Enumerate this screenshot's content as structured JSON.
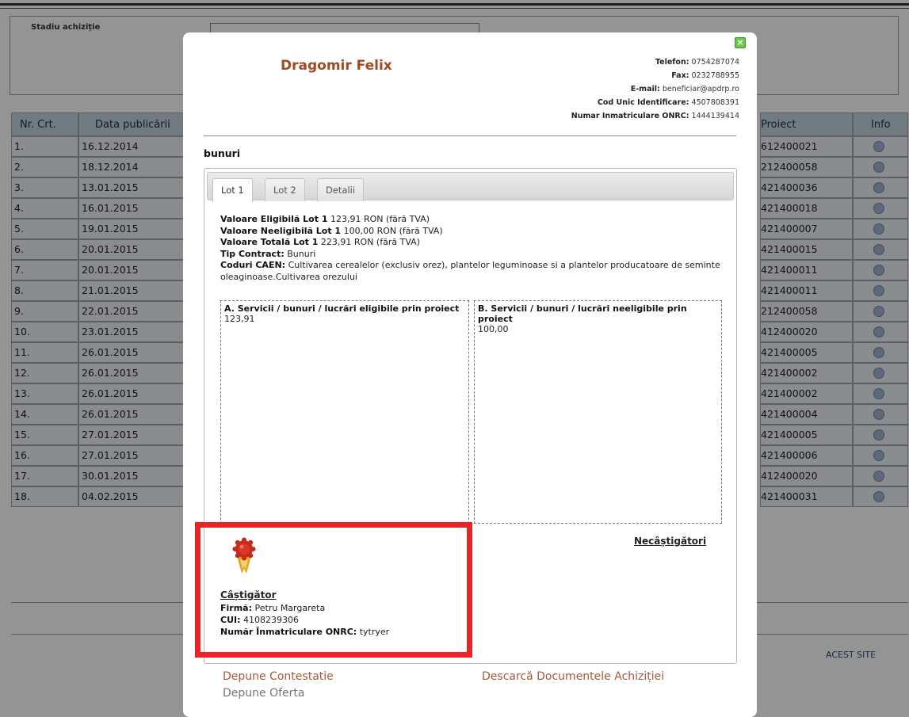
{
  "filter": {
    "label": "Stadiu achiziție"
  },
  "table": {
    "headers": [
      "Nr. Crt.",
      "Data publicării",
      "Proiect",
      "Info"
    ],
    "rows": [
      {
        "nr": "1.",
        "date": "16.12.2014",
        "proj": "612400021"
      },
      {
        "nr": "2.",
        "date": "18.12.2014",
        "proj": "212400058"
      },
      {
        "nr": "3.",
        "date": "13.01.2015",
        "proj": "421400036"
      },
      {
        "nr": "4.",
        "date": "16.01.2015",
        "proj": "421400018"
      },
      {
        "nr": "5.",
        "date": "19.01.2015",
        "proj": "421400007"
      },
      {
        "nr": "6.",
        "date": "20.01.2015",
        "proj": "421400015"
      },
      {
        "nr": "7.",
        "date": "20.01.2015",
        "proj": "421400011"
      },
      {
        "nr": "8.",
        "date": "21.01.2015",
        "proj": "421400011"
      },
      {
        "nr": "9.",
        "date": "22.01.2015",
        "proj": "212400058"
      },
      {
        "nr": "10.",
        "date": "23.01.2015",
        "proj": "412400020"
      },
      {
        "nr": "11.",
        "date": "26.01.2015",
        "proj": "421400005"
      },
      {
        "nr": "12.",
        "date": "26.01.2015",
        "proj": "421400002"
      },
      {
        "nr": "13.",
        "date": "26.01.2015",
        "proj": "421400002"
      },
      {
        "nr": "14.",
        "date": "26.01.2015",
        "proj": "421400004"
      },
      {
        "nr": "15.",
        "date": "27.01.2015",
        "proj": "421400005"
      },
      {
        "nr": "16.",
        "date": "27.01.2015",
        "proj": "421400006"
      },
      {
        "nr": "17.",
        "date": "30.01.2015",
        "proj": "412400020"
      },
      {
        "nr": "18.",
        "date": "04.02.2015",
        "proj": "421400031"
      }
    ]
  },
  "site_link": "ACEST SITE",
  "modal": {
    "beneficiary": "Dragomir Felix",
    "contact": {
      "phone_label": "Telefon:",
      "phone": "0754287074",
      "fax_label": "Fax:",
      "fax": "0232788955",
      "email_label": "E-mail:",
      "email": "beneficiar@apdrp.ro",
      "cui_label": "Cod Unic Identificare:",
      "cui": "4507808391",
      "onrc_label": "Numar Inmatriculare ONRC:",
      "onrc": "1444139414"
    },
    "section": "bunuri",
    "tabs": [
      "Lot 1",
      "Lot 2",
      "Detalii"
    ],
    "lot": {
      "eligible_label": "Valoare Eligibilă Lot 1",
      "eligible_value": "123,91 RON (fără TVA)",
      "neeligible_label": "Valoare Neeligibilă Lot 1",
      "neeligible_value": "100,00 RON (fără TVA)",
      "total_label": "Valoare Totală Lot 1",
      "total_value": "223,91 RON (fără TVA)",
      "contract_label": "Tip Contract:",
      "contract_value": "Bunuri",
      "caen_label": "Coduri CAEN:",
      "caen_value": "Cultivarea cerealelor (exclusiv orez), plantelor leguminoase si a plantelor producatoare de seminte oleaginoase.Cultivarea orezului"
    },
    "box_a": {
      "title": "A. Servicii / bunuri / lucrări eligibile prin proiect",
      "value": "123,91"
    },
    "box_b": {
      "title": "B. Servicii / bunuri / lucrări neeligibile prin proiect",
      "value": "100,00"
    },
    "losers_link": "Necâștigători",
    "winner": {
      "title": "Câștigător",
      "firm_label": "Firmă:",
      "firm": "Petru Margareta",
      "cui_label": "CUI:",
      "cui": "4108239306",
      "onrc_label": "Număr Înmatriculare ONRC:",
      "onrc": "tytryer"
    },
    "links": {
      "contest": "Depune Contestatie",
      "offer": "Depune Oferta",
      "docs": "Descarcă Documentele Achiziției"
    },
    "icons": {
      "close": "close-icon",
      "medal": "award-medal-icon",
      "info": "info-icon"
    },
    "colors": {
      "highlight": "#e8242b",
      "beneficiary": "#a04a24",
      "link": "#a5593a"
    }
  }
}
